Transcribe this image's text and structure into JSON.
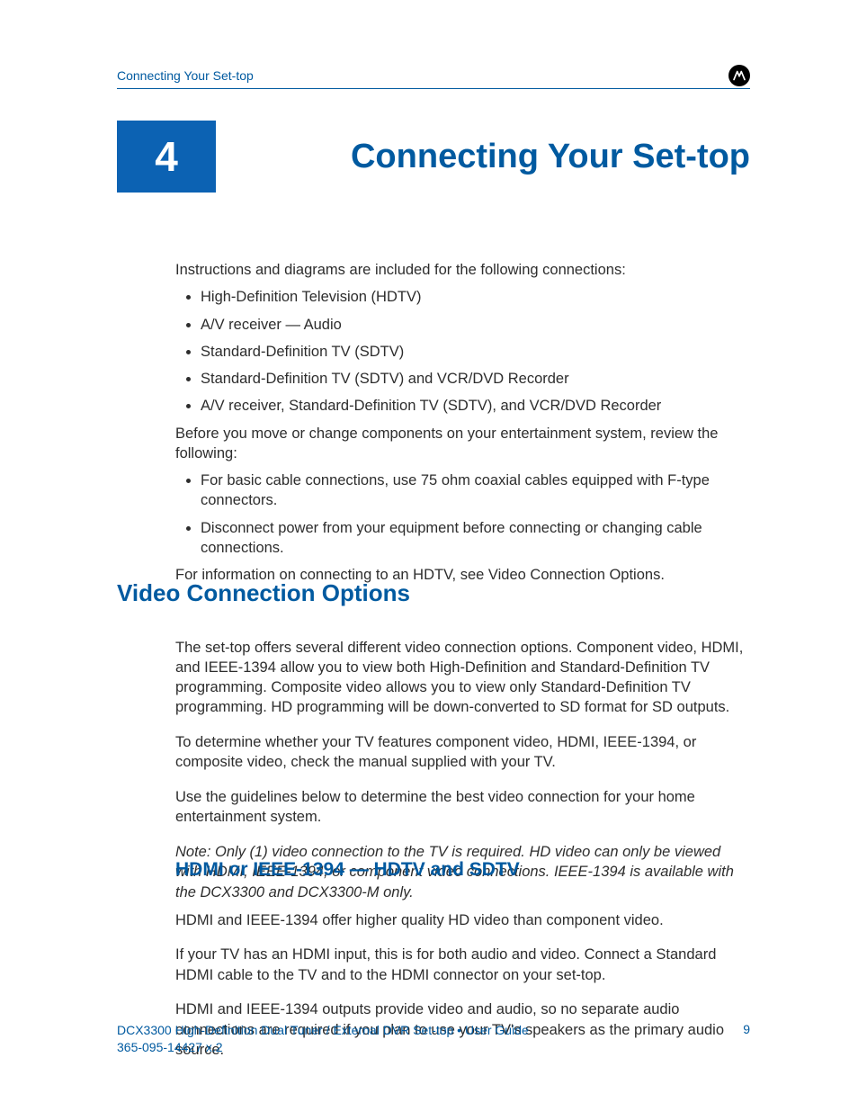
{
  "header": {
    "section": "Connecting Your Set-top"
  },
  "chapter": {
    "number": "4",
    "title": "Connecting Your Set-top"
  },
  "intro": {
    "lead": "Instructions and diagrams are included for the following connections:",
    "connections": [
      "High-Definition Television (HDTV)",
      "A/V receiver — Audio",
      "Standard-Definition TV (SDTV)",
      "Standard-Definition TV (SDTV) and VCR/DVD Recorder",
      "A/V receiver, Standard-Definition TV (SDTV), and VCR/DVD Recorder"
    ],
    "before": "Before you move or change components on your entertainment system, review the following:",
    "cautions": [
      "For basic cable connections, use 75 ohm coaxial cables equipped with F-type connectors.",
      "Disconnect power from your equipment before connecting or changing cable connections."
    ],
    "after": "For information on connecting to an HDTV, see Video Connection Options."
  },
  "video": {
    "heading": "Video Connection Options",
    "p1": "The set-top offers several different video connection options. Component video, HDMI, and IEEE-1394 allow you to view both High-Definition and Standard-Definition TV programming. Composite video allows you to view only Standard-Definition TV programming. HD programming will be down-converted to SD format for SD outputs.",
    "p2": "To determine whether your TV features component video, HDMI, IEEE-1394, or composite video, check the manual supplied with your TV.",
    "p3": "Use the guidelines below to determine the best video connection for your home entertainment system.",
    "note": "Note: Only (1) video connection to the TV is required. HD video can only be viewed with HDMI, IEEE-1394, or component video connections. IEEE-1394 is available with the DCX3300 and DCX3300-M only."
  },
  "hdmi": {
    "heading": "HDMI or IEEE-1394 — HDTV and SDTV",
    "p1": "HDMI and IEEE-1394 offer higher quality HD video than component video.",
    "p2": "If your TV has an HDMI input, this is for both audio and video. Connect a Standard HDMI cable to the TV and to the HDMI connector on your set-top.",
    "p3": "HDMI and IEEE-1394 outputs provide video and audio, so no separate audio connections are required if you plan to use your TV's speakers as the primary audio source."
  },
  "footer": {
    "product": "DCX3300 High-Definition Dual Tuner / External DVR Set-top • User Guide",
    "docnum": "365-095-14427 x.2",
    "page": "9"
  }
}
